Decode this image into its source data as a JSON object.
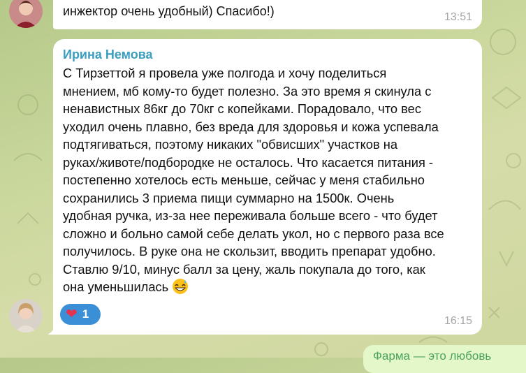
{
  "messages": [
    {
      "text_visible": "инжектор очень удобный) Спасибо!)",
      "time": "13:51"
    },
    {
      "sender": "Ирина Немова",
      "text": "С Тирзеттой я провела уже полгода и хочу поделиться\nмнением, мб кому-то будет полезно. За это время я скинула с\nненавистных 86кг до 70кг с копейками. Порадовало, что вес\nуходил очень плавно, без вреда для здоровья и кожа успевала\nподтягиваться, поэтому никаких \"обвисших\" участков на\nруках/животе/подбородке не осталось. Что касается питания -\nпостепенно хотелось есть меньше, сейчас у меня стабильно\nсохранились 3 приема пищи суммарно на 1500к. Очень\nудобная ручка, из-за нее переживала больше всего - что будет\nсложно и больно самой себе делать укол, но с первого раза все\nполучилось. В руке она не скользит, вводить препарат удобно.\nСтавлю 9/10, минус балл за цену, жаль покупала до того, как\nона уменьшилась",
      "emoji": "grinning-sweat-emoji",
      "reaction": {
        "icon": "red-heart",
        "count": "1"
      },
      "time": "16:15"
    }
  ],
  "outgoing_preview": "Фарма — это любовь",
  "colors": {
    "sender_name": "#3a9fbf",
    "reaction_bg": "#3a8fd6",
    "time": "#a5a5a5"
  }
}
